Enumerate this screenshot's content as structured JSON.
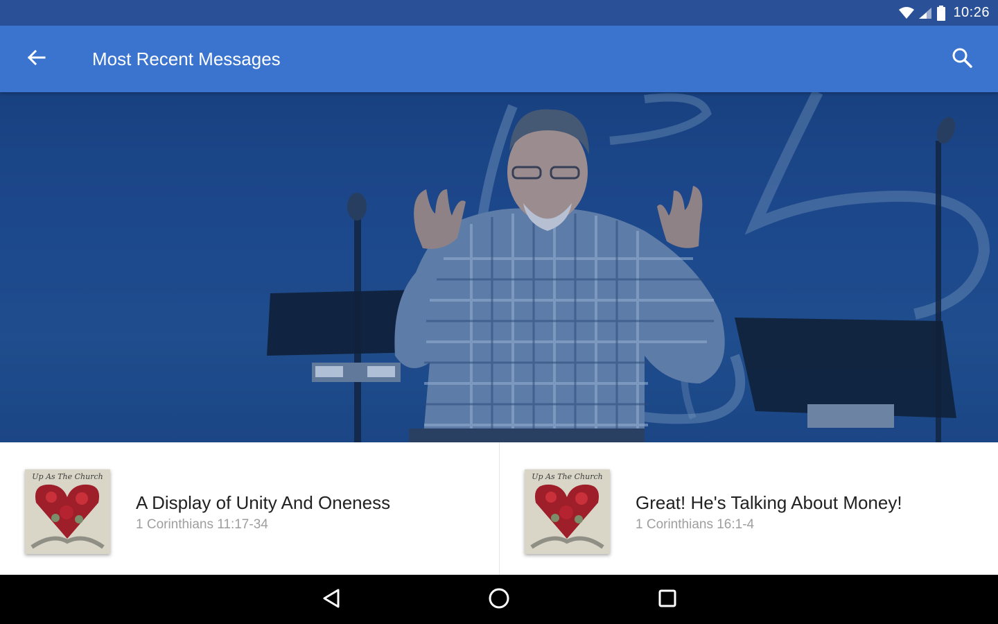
{
  "status_bar": {
    "time": "10:26",
    "icons": [
      "wifi-icon",
      "cell-signal-icon",
      "battery-icon"
    ]
  },
  "app_bar": {
    "title": "Most Recent Messages",
    "back_icon": "arrow-back-icon",
    "search_icon": "search-icon"
  },
  "hero": {
    "image": "speaker-on-stage-photo"
  },
  "messages": [
    {
      "title": "A Display of Unity And Oneness",
      "reference": "1 Corinthians 11:17-34",
      "thumbnail_title": "Up As The Church"
    },
    {
      "title": "Great! He's Talking About Money!",
      "reference": "1 Corinthians 16:1-4",
      "thumbnail_title": "Up As The Church"
    }
  ],
  "nav_bar": {
    "buttons": [
      "back-triangle-icon",
      "home-circle-icon",
      "recents-square-icon"
    ]
  },
  "colors": {
    "status_bar": "#2a5198",
    "app_bar": "#3b74cf",
    "hero_tint": "#1e4a8e",
    "title_text": "#212121",
    "subtitle_text": "#9e9e9e"
  }
}
